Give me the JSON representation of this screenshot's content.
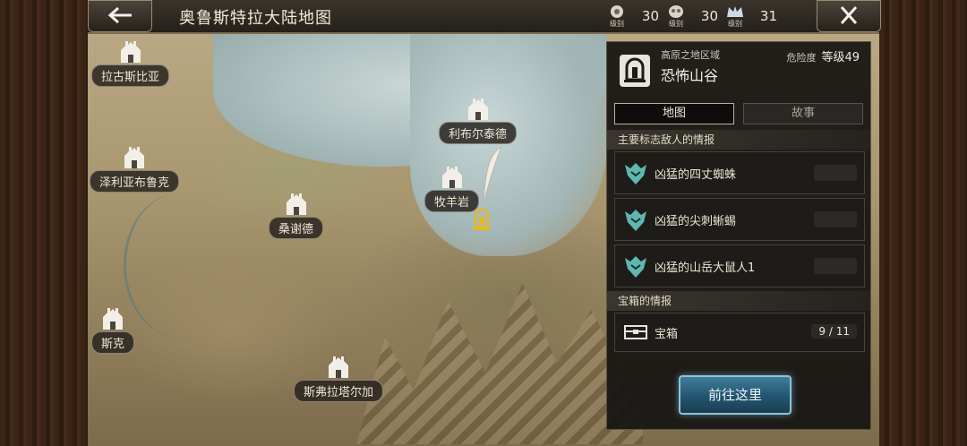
{
  "header": {
    "title": "奥鲁斯特拉大陆地图",
    "back_icon": "arrow-left-icon",
    "close_icon": "close-x-icon",
    "levels": [
      {
        "icon": "rank-badge-icon",
        "caption": "级别",
        "value": "30"
      },
      {
        "icon": "skull-badge-icon",
        "caption": "级别",
        "value": "30"
      },
      {
        "icon": "crown-badge-icon",
        "caption": "级别",
        "value": "31"
      }
    ]
  },
  "map": {
    "locations": [
      {
        "label": "拉古斯比亚"
      },
      {
        "label": "泽利亚布鲁克"
      },
      {
        "label": "桑谢德"
      },
      {
        "label": "利布尔泰德"
      },
      {
        "label": "牧羊岩"
      },
      {
        "label": "斯克"
      },
      {
        "label": "斯弗拉塔尔加"
      }
    ]
  },
  "panel": {
    "region_sub": "高原之地区域",
    "region_name": "恐怖山谷",
    "danger_label": "危险度",
    "danger_value": "等级49",
    "tabs": [
      {
        "label": "地图",
        "active": true
      },
      {
        "label": "故事",
        "active": false
      }
    ],
    "enemy_section_title": "主要标志敌人的情报",
    "enemies": [
      {
        "name": "凶猛的四丈蜘蛛"
      },
      {
        "name": "凶猛的尖刺蜥蜴"
      },
      {
        "name": "凶猛的山岳大鼠人1"
      }
    ],
    "chest_section_title": "宝箱的情报",
    "chest": {
      "name": "宝箱",
      "count": "9 / 11"
    },
    "go_button": "前往这里"
  },
  "colors": {
    "accent_button": "#2f6f8c",
    "marker_gold": "#e8b820"
  }
}
